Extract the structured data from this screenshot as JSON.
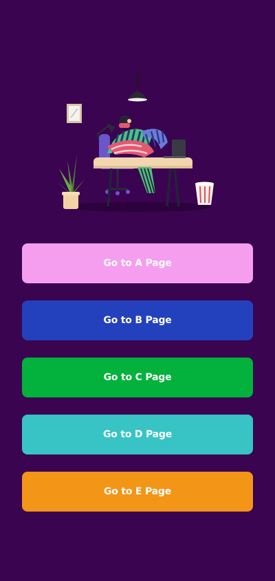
{
  "illustration": {
    "name": "person-at-desk-illustration"
  },
  "buttons": [
    {
      "label": "Go to A Page",
      "color": "#f59ef0"
    },
    {
      "label": "Go to B Page",
      "color": "#2340bd"
    },
    {
      "label": "Go to C Page",
      "color": "#02b23c"
    },
    {
      "label": "Go to D Page",
      "color": "#38c4c4"
    },
    {
      "label": "Go to E Page",
      "color": "#f39517"
    }
  ]
}
